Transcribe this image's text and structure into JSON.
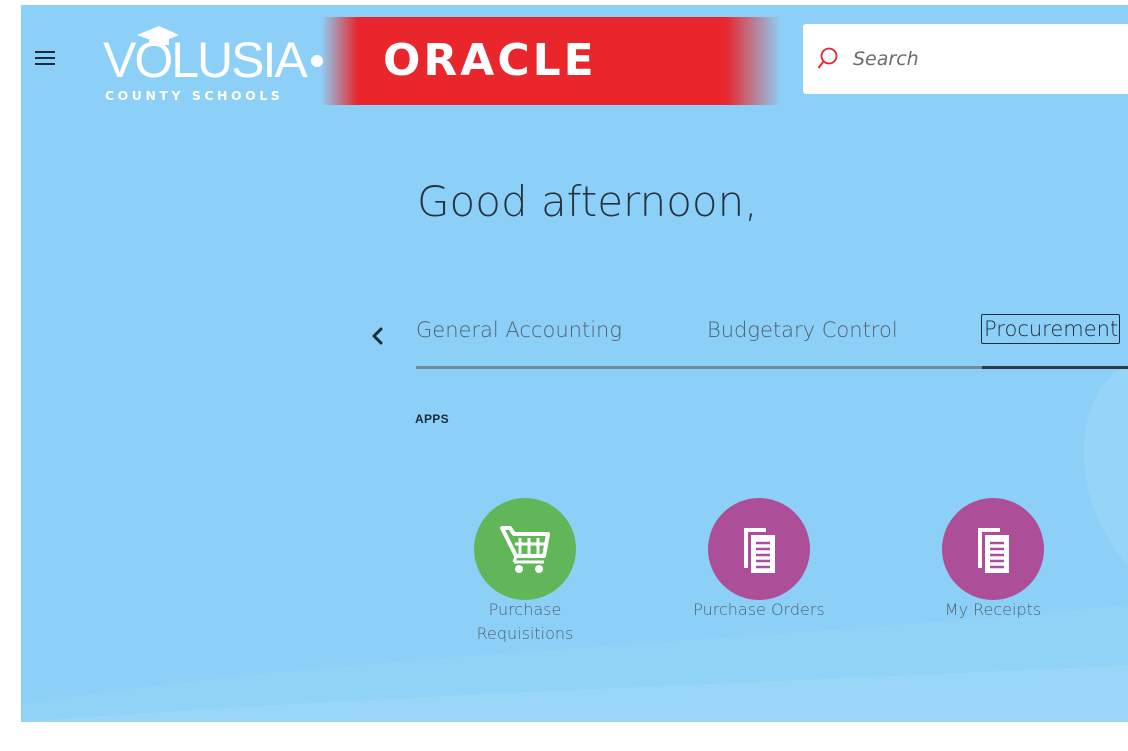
{
  "header": {
    "menu_icon": "hamburger-menu-icon",
    "logo_primary": "VOLUSIA",
    "logo_secondary": "COUNTY SCHOOLS",
    "logo_brand": "ORACLE",
    "brand_color": "#e8262c",
    "search": {
      "placeholder": "Search",
      "value": "",
      "icon": "search-icon"
    }
  },
  "greeting": "Good afternoon,",
  "tabs": {
    "prev_icon": "chevron-left-icon",
    "items": [
      {
        "label": "General Accounting",
        "active": false
      },
      {
        "label": "Budgetary Control",
        "active": false
      },
      {
        "label": "Procurement",
        "active": true
      }
    ]
  },
  "apps": {
    "heading": "APPS",
    "items": [
      {
        "label_line1": "Purchase",
        "label_line2": "Requisitions",
        "icon": "shopping-cart-icon",
        "color": "#62b65a"
      },
      {
        "label": "Purchase Orders",
        "icon": "document-copy-icon",
        "color": "#ad4e98"
      },
      {
        "label": "My Receipts",
        "icon": "document-copy-icon",
        "color": "#ad4e98"
      }
    ]
  },
  "colors": {
    "background": "#8dd0f7",
    "text_dark": "#25323f",
    "text_muted": "#4f5f70"
  }
}
